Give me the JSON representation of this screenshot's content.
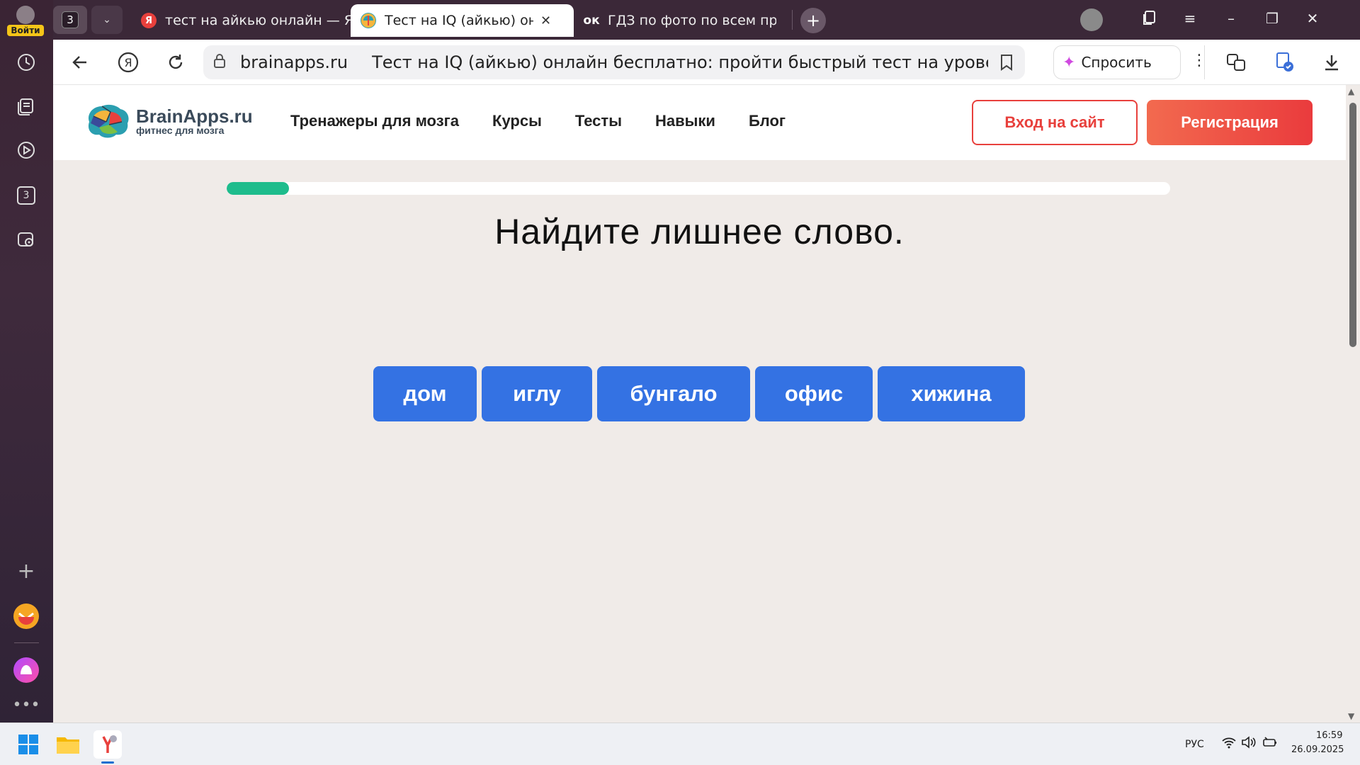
{
  "sidebar": {
    "login_label": "Войти",
    "items": [
      "history-icon",
      "collections-icon",
      "video-icon",
      "tab-counter-icon",
      "screenshot-icon"
    ],
    "tab_counter": "3"
  },
  "tabs": {
    "counter": "3",
    "items": [
      {
        "title": "тест на айкью онлайн — Я",
        "favicon": "Я",
        "favicon_color": "#e8403c"
      },
      {
        "title": "Тест на IQ (айкью) онла",
        "favicon": "",
        "favicon_color": "#2b9fb0",
        "active": true
      },
      {
        "title": "ГДЗ по фото по всем пред",
        "favicon": "ок",
        "favicon_color": "#3b2838"
      }
    ]
  },
  "addressbar": {
    "domain": "brainapps.ru",
    "page_title": "Тест на IQ (айкью) онлайн бесплатно: пройти быстрый тест на уровень I...",
    "ask_label": "Спросить"
  },
  "site": {
    "logo_name": "BrainApps.ru",
    "logo_tag": "фитнес для мозга",
    "nav": [
      "Тренажеры для мозга",
      "Курсы",
      "Тесты",
      "Навыки",
      "Блог"
    ],
    "login": "Вход на сайт",
    "register": "Регистрация"
  },
  "quiz": {
    "progress_percent": 6.6,
    "question": "Найдите лишнее слово.",
    "answers": [
      "дом",
      "иглу",
      "бунгало",
      "офис",
      "хижина"
    ]
  },
  "taskbar": {
    "lang": "РУС",
    "time": "16:59",
    "date": "26.09.2025"
  },
  "colors": {
    "accent_blue": "#3472e3",
    "accent_red": "#e8403c",
    "progress": "#1ebc8c"
  }
}
